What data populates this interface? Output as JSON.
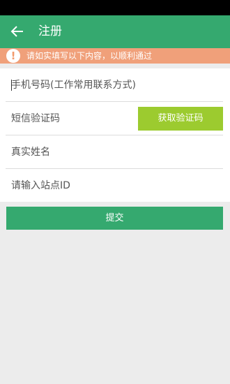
{
  "app_bar": {
    "title": "注册",
    "back_icon": "arrow-left-icon",
    "color": "#35a96f"
  },
  "notice": {
    "icon": "exclamation-icon",
    "text": "请如实填写以下内容，以顺利通过",
    "color": "#f0a07a"
  },
  "form": {
    "phone_placeholder": "手机号码(工作常用联系方式)",
    "code_placeholder": "短信验证码",
    "get_code_label": "获取验证码",
    "name_placeholder": "真实姓名",
    "site_placeholder": "请输入站点ID"
  },
  "actions": {
    "submit_label": "提交",
    "get_code_color": "#9ccb2f"
  }
}
